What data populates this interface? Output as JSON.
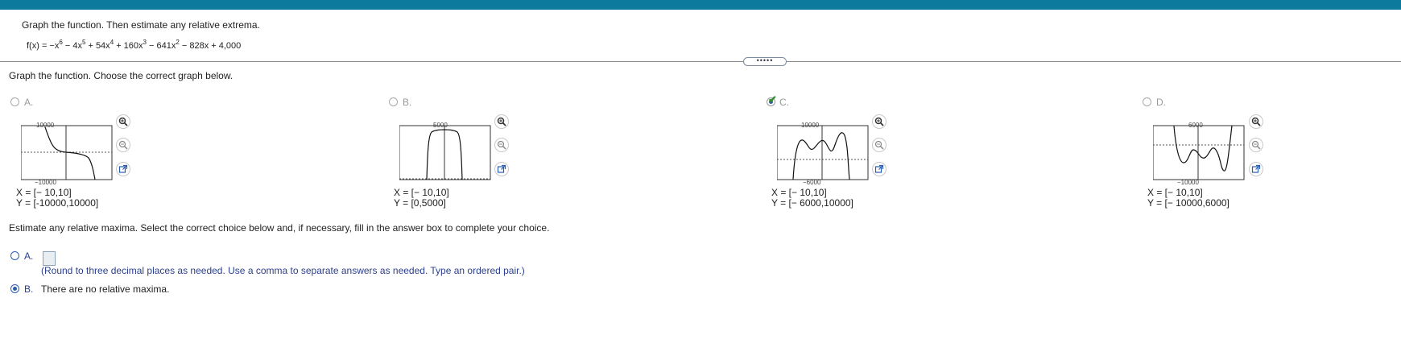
{
  "question": {
    "instruction": "Graph the function. Then estimate any relative extrema.",
    "function": {
      "lhs": "f(x) = −x",
      "e1": "6",
      "t2": " − 4x",
      "e2": "5",
      "t3": " + 54x",
      "e3": "4",
      "t4": " + 160x",
      "e4": "3",
      "t5": " − 641x",
      "e5": "2",
      "t6": " − 828x + 4,000"
    }
  },
  "more_button": "•••••",
  "part1": {
    "prompt": "Graph the function. Choose the correct graph below.",
    "options": [
      {
        "letter": "A.",
        "ymax": "10000",
        "ymin": "−10000",
        "xrange": "X = [− 10,10]",
        "yrange": "Y = [-10000,10000]",
        "selected": false
      },
      {
        "letter": "B.",
        "ymax": "5000",
        "ymin": "",
        "xrange": "X = [− 10,10]",
        "yrange": "Y = [0,5000]",
        "selected": false
      },
      {
        "letter": "C.",
        "ymax": "10000",
        "ymin": "−6000",
        "xrange": "X = [− 10,10]",
        "yrange": "Y = [− 6000,10000]",
        "selected": true
      },
      {
        "letter": "D.",
        "ymax": "6000",
        "ymin": "−10000",
        "xrange": "X = [− 10,10]",
        "yrange": "Y = [− 10000,6000]",
        "selected": false
      }
    ],
    "check_mark": "✔"
  },
  "part2": {
    "prompt": "Estimate any relative maxima. Select the correct choice below and, if necessary, fill in the answer box to complete your choice.",
    "optionA": {
      "letter": "A.",
      "input_value": "",
      "hint": "(Round to three decimal places as needed. Use a comma to separate answers as needed. Type an ordered pair.)",
      "selected": false
    },
    "optionB": {
      "letter": "B.",
      "text": "There are no relative maxima.",
      "selected": true
    }
  },
  "icons": [
    "zoom-in-icon",
    "zoom-out-icon",
    "open-new-window-icon"
  ]
}
